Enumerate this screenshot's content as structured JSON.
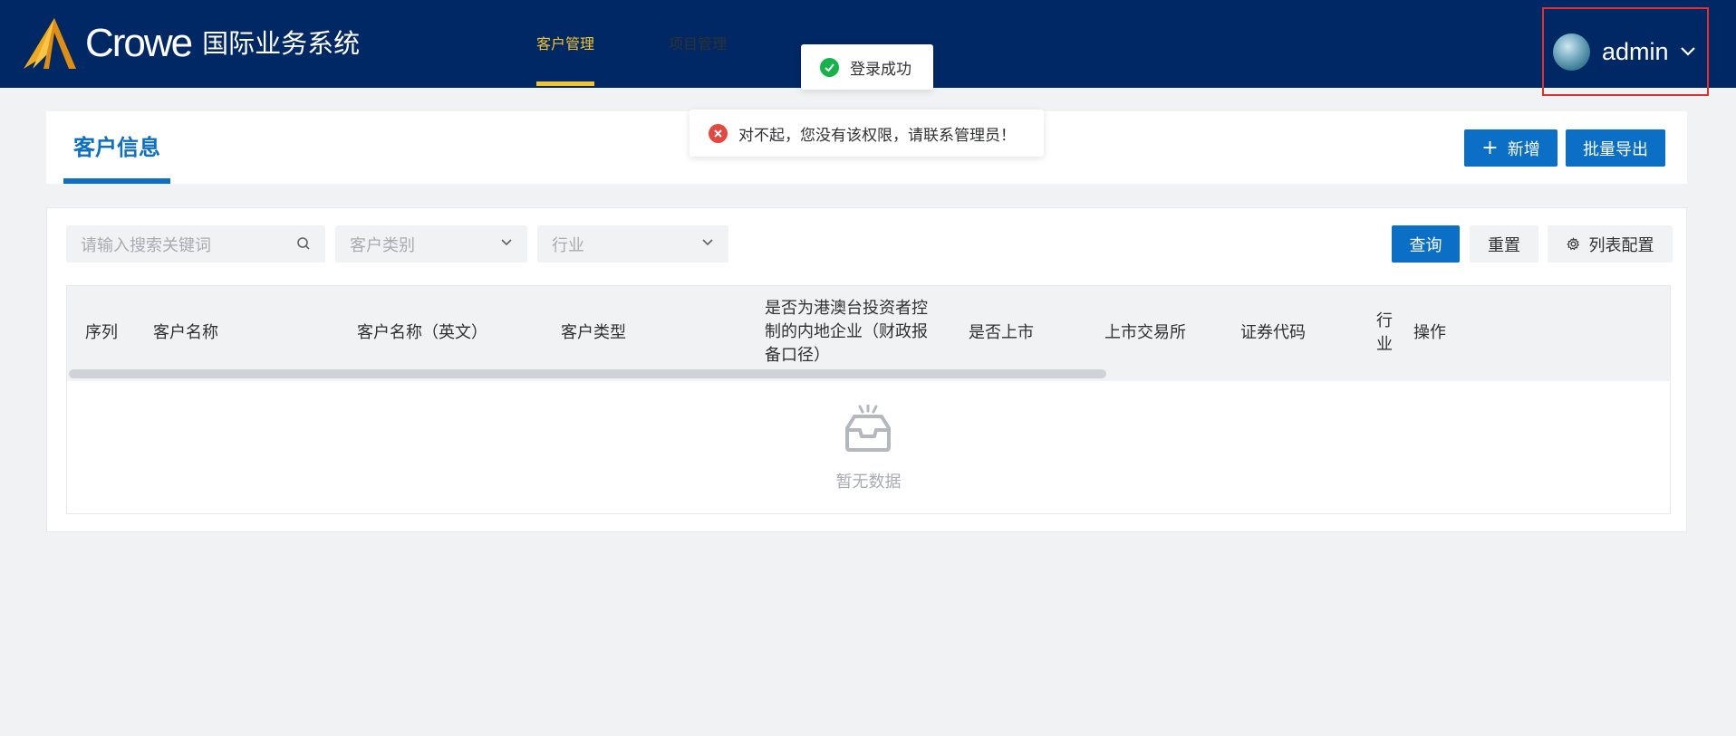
{
  "header": {
    "logo_word": "Crowe",
    "logo_subtitle": "国际业务系统",
    "nav": [
      {
        "label": "客户管理",
        "active": true
      },
      {
        "label": "项目管理",
        "active": false
      }
    ],
    "user": {
      "name": "admin",
      "avatar_icon": "avatar-icon",
      "chevron_icon": "chevron-down-icon"
    }
  },
  "toasts": {
    "success": {
      "text": "登录成功",
      "icon": "check-circle-icon",
      "color": "#16b34a"
    },
    "error": {
      "text": "对不起，您没有该权限，请联系管理员！",
      "icon": "x-circle-icon",
      "color": "#e5483e"
    }
  },
  "page": {
    "tab_title": "客户信息",
    "add_button": "新增",
    "export_button": "批量导出"
  },
  "filters": {
    "search_placeholder": "请输入搜索关键词",
    "type_placeholder": "客户类别",
    "industry_placeholder": "行业",
    "query_button": "查询",
    "reset_button": "重置",
    "config_button": "列表配置"
  },
  "table": {
    "columns": [
      "序列",
      "客户名称",
      "客户名称（英文）",
      "客户类型",
      "是否为港澳台投资者控制的内地企业（财政报备口径）",
      "是否上市",
      "上市交易所",
      "证券代码",
      "行业口径",
      "操作"
    ],
    "empty_text": "暂无数据"
  },
  "colors": {
    "header_bg": "#002864",
    "accent": "#0b6fc6",
    "nav_active": "#f5c230",
    "highlight_border": "#e03131"
  }
}
